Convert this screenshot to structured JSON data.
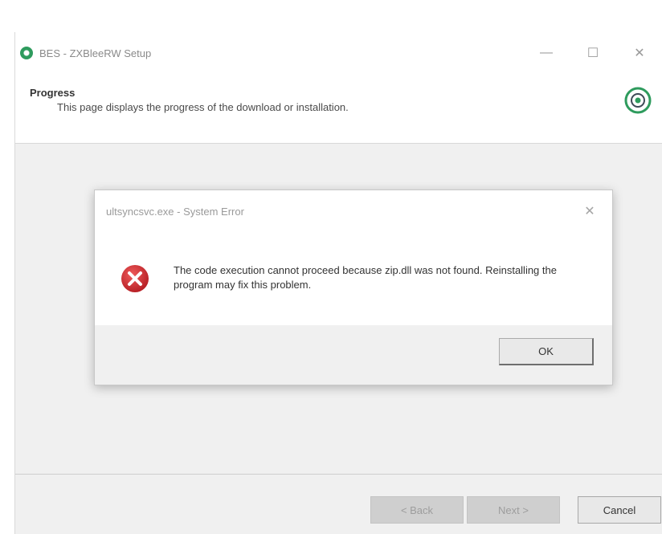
{
  "setup_window": {
    "title": "BES - ZXBleeRW Setup",
    "controls": {
      "minimize": "—",
      "maximize": "☐",
      "close": "✕"
    },
    "header": {
      "title": "Progress",
      "subtitle": "This page displays the progress of the download or installation."
    },
    "buttons": {
      "back": "< Back",
      "next": "Next >",
      "cancel": "Cancel"
    }
  },
  "error_dialog": {
    "title": "ultsyncsvc.exe - System Error",
    "close": "✕",
    "message": "The code execution cannot proceed because zip.dll was not found. Reinstalling the program may fix this problem.",
    "ok_label": "OK"
  },
  "colors": {
    "error_red": "#c9262d",
    "logo_green": "#2e9b5d"
  }
}
